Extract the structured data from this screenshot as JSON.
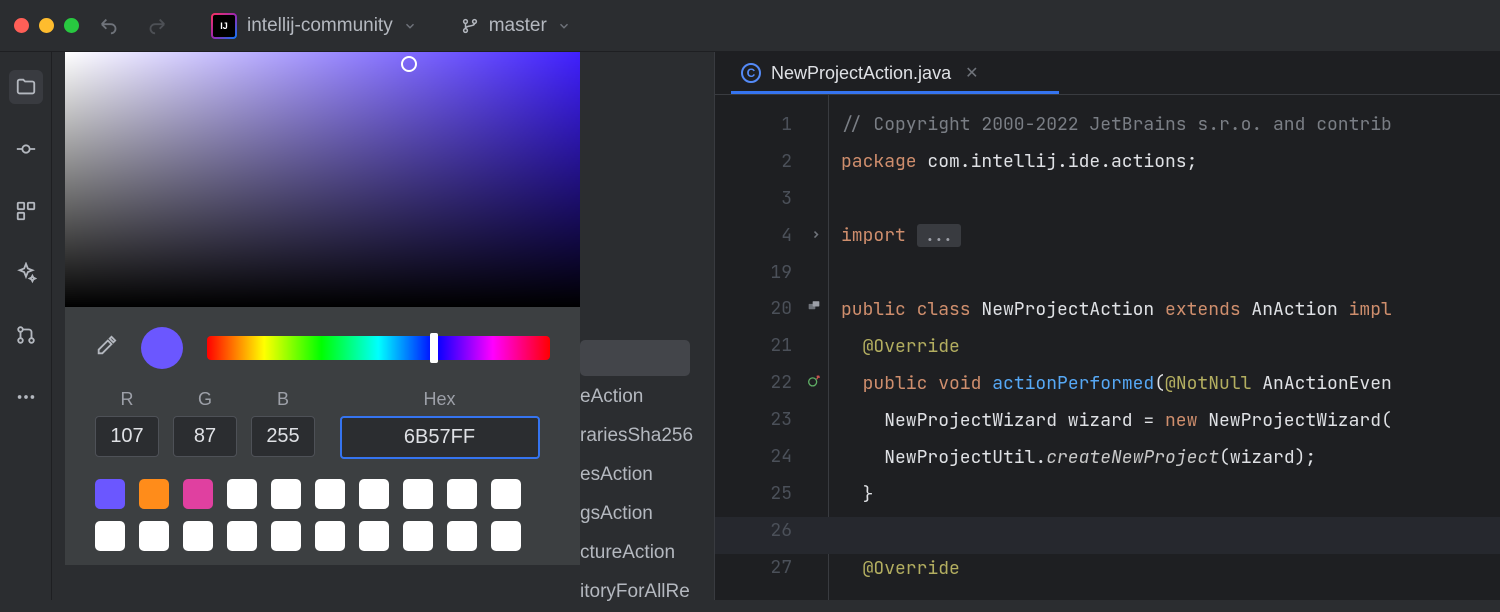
{
  "titlebar": {
    "ij_label": "IJ",
    "project_name": "intellij-community",
    "branch_name": "master"
  },
  "color_picker": {
    "labels": {
      "r": "R",
      "g": "G",
      "b": "B",
      "hex": "Hex"
    },
    "values": {
      "r": "107",
      "g": "87",
      "b": "255",
      "hex": "6B57FF"
    },
    "preview_color": "#6b57ff",
    "swatches_row1": [
      "#6b57ff",
      "#ff8c1a",
      "#e040a0",
      "#ffffff",
      "#ffffff",
      "#ffffff",
      "#ffffff",
      "#ffffff",
      "#ffffff",
      "#ffffff"
    ],
    "swatches_row2": [
      "#ffffff",
      "#ffffff",
      "#ffffff",
      "#ffffff",
      "#ffffff",
      "#ffffff",
      "#ffffff",
      "#ffffff",
      "#ffffff",
      "#ffffff"
    ]
  },
  "bg_list": {
    "items": [
      "eAction",
      "rariesSha256",
      "esAction",
      "gsAction",
      "ctureAction",
      "itoryForAllRe"
    ]
  },
  "editor": {
    "tab": {
      "name": "NewProjectAction.java",
      "icon_letter": "C"
    },
    "lines": [
      {
        "num": "1",
        "parts": [
          {
            "cls": "cm-comment",
            "t": "// Copyright 2000-2022 JetBrains s.r.o. and contrib"
          }
        ]
      },
      {
        "num": "2",
        "parts": [
          {
            "cls": "cm-keyword",
            "t": "package "
          },
          {
            "cls": "cm-type",
            "t": "com.intellij.ide.actions;"
          }
        ]
      },
      {
        "num": "3",
        "parts": []
      },
      {
        "num": "4",
        "fold": true,
        "parts": [
          {
            "cls": "cm-keyword",
            "t": "import "
          },
          {
            "cls": "cm-fold",
            "t": "..."
          }
        ]
      },
      {
        "num": "19",
        "parts": []
      },
      {
        "num": "20",
        "icon": "impl",
        "parts": [
          {
            "cls": "cm-keyword",
            "t": "public class "
          },
          {
            "cls": "cm-type",
            "t": "NewProjectAction "
          },
          {
            "cls": "cm-keyword",
            "t": "extends "
          },
          {
            "cls": "cm-type",
            "t": "AnAction "
          },
          {
            "cls": "cm-keyword",
            "t": "impl"
          }
        ]
      },
      {
        "num": "21",
        "parts": [
          {
            "cls": "",
            "t": "  "
          },
          {
            "cls": "cm-annotation",
            "t": "@Override"
          }
        ]
      },
      {
        "num": "22",
        "icon": "override",
        "parts": [
          {
            "cls": "",
            "t": "  "
          },
          {
            "cls": "cm-keyword",
            "t": "public void "
          },
          {
            "cls": "cm-func",
            "t": "actionPerformed"
          },
          {
            "cls": "",
            "t": "("
          },
          {
            "cls": "cm-annotation",
            "t": "@NotNull "
          },
          {
            "cls": "cm-type",
            "t": "AnActionEven"
          }
        ]
      },
      {
        "num": "23",
        "parts": [
          {
            "cls": "",
            "t": "    NewProjectWizard wizard = "
          },
          {
            "cls": "cm-keyword",
            "t": "new "
          },
          {
            "cls": "cm-type",
            "t": "NewProjectWizard("
          }
        ]
      },
      {
        "num": "24",
        "parts": [
          {
            "cls": "",
            "t": "    NewProjectUtil."
          },
          {
            "cls": "cm-funcstatic",
            "t": "createNewProject"
          },
          {
            "cls": "",
            "t": "(wizard);"
          }
        ]
      },
      {
        "num": "25",
        "parts": [
          {
            "cls": "",
            "t": "  }"
          }
        ]
      },
      {
        "num": "26",
        "parts": []
      },
      {
        "num": "27",
        "parts": [
          {
            "cls": "",
            "t": "  "
          },
          {
            "cls": "cm-annotation",
            "t": "@Override"
          }
        ]
      }
    ]
  }
}
